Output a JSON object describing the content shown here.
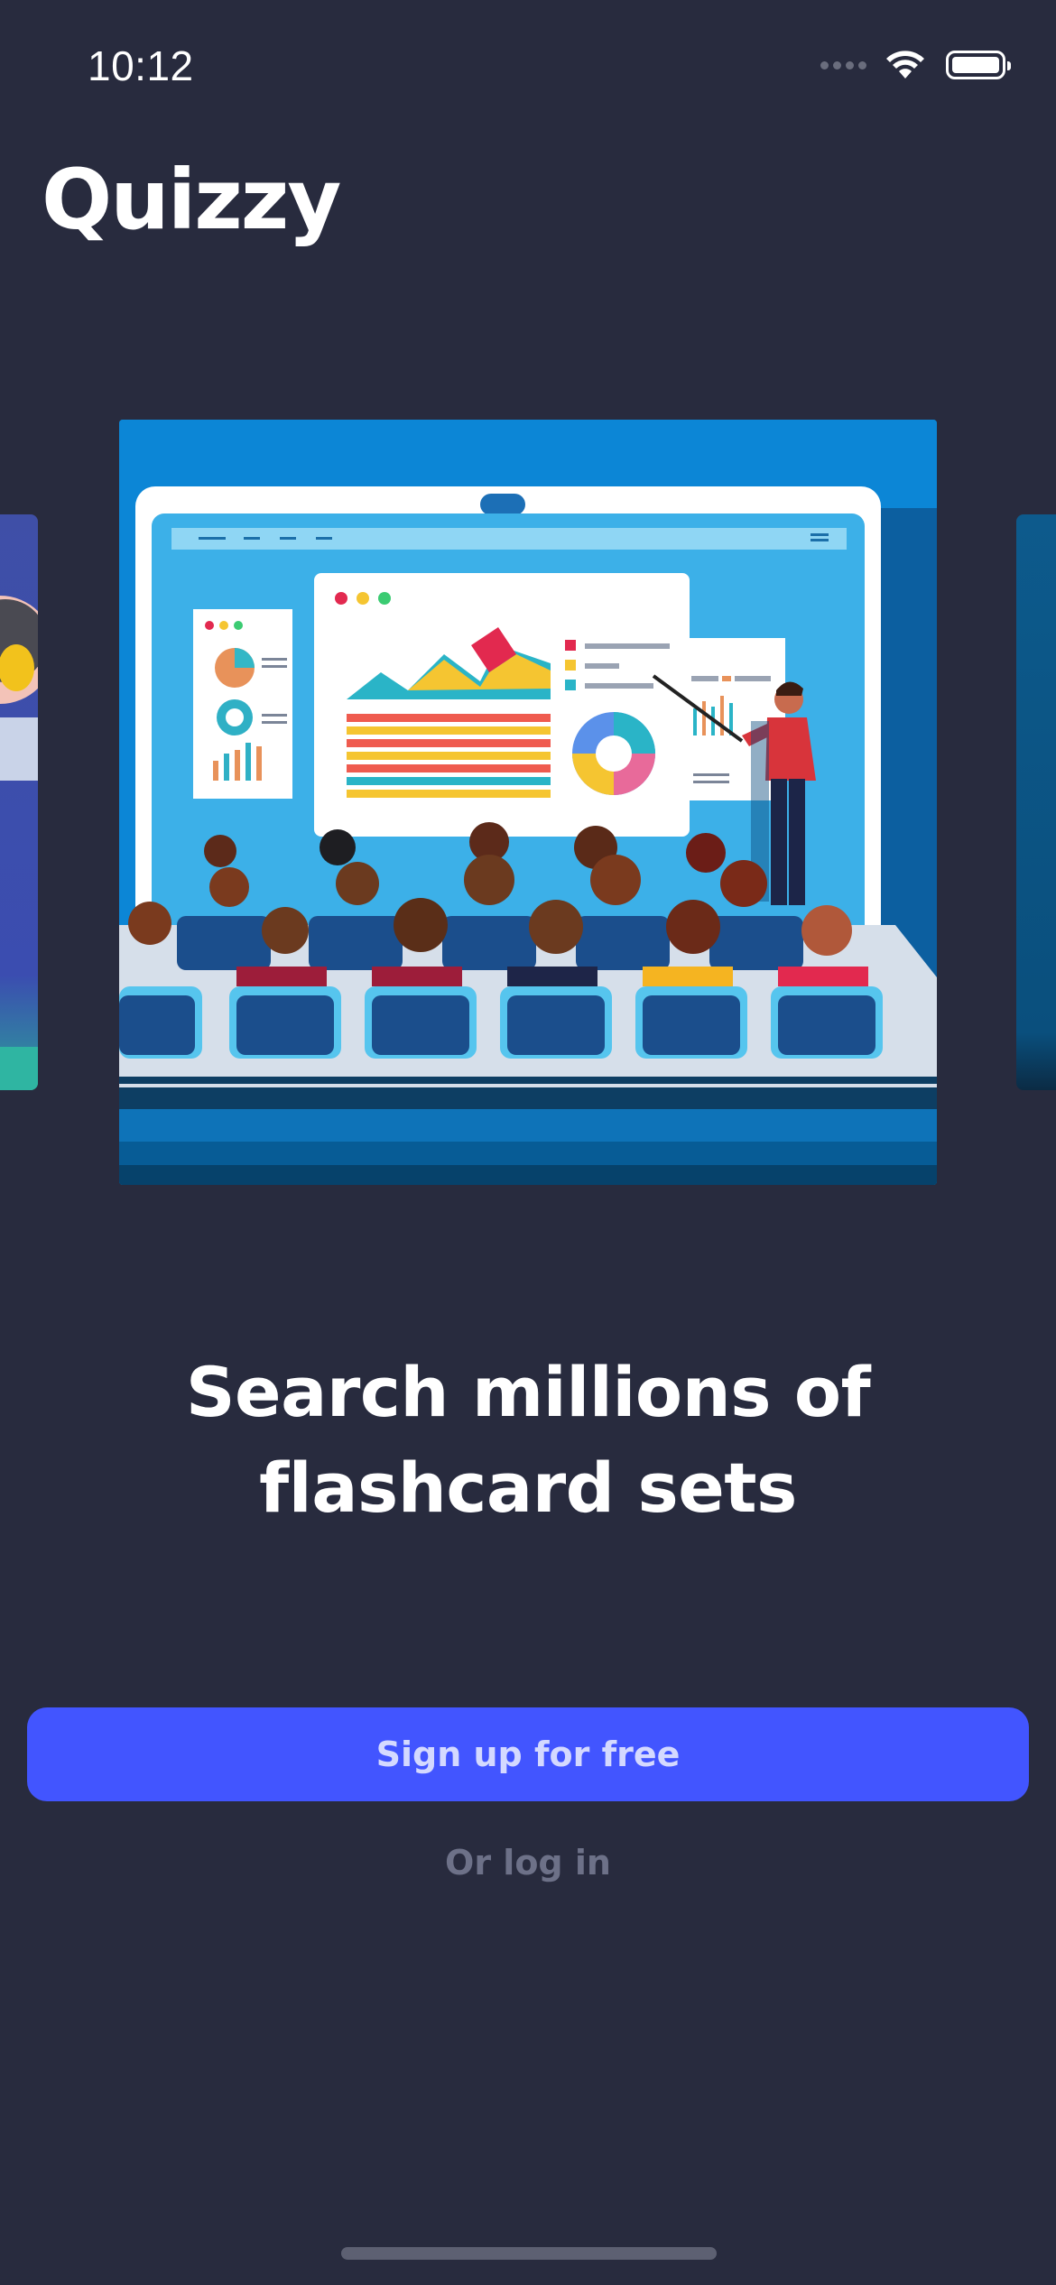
{
  "status_bar": {
    "time": "10:12"
  },
  "app": {
    "name": "Quizzy"
  },
  "onboarding": {
    "illustration": "presenter-classroom-illustration",
    "headline_line1": "Search millions of",
    "headline_line2": "flashcard sets"
  },
  "actions": {
    "signup_label": "Sign up for free",
    "login_label": "Or log in"
  },
  "colors": {
    "background": "#282b3e",
    "primary_button": "#4255ff",
    "secondary_text": "#6d7188"
  }
}
